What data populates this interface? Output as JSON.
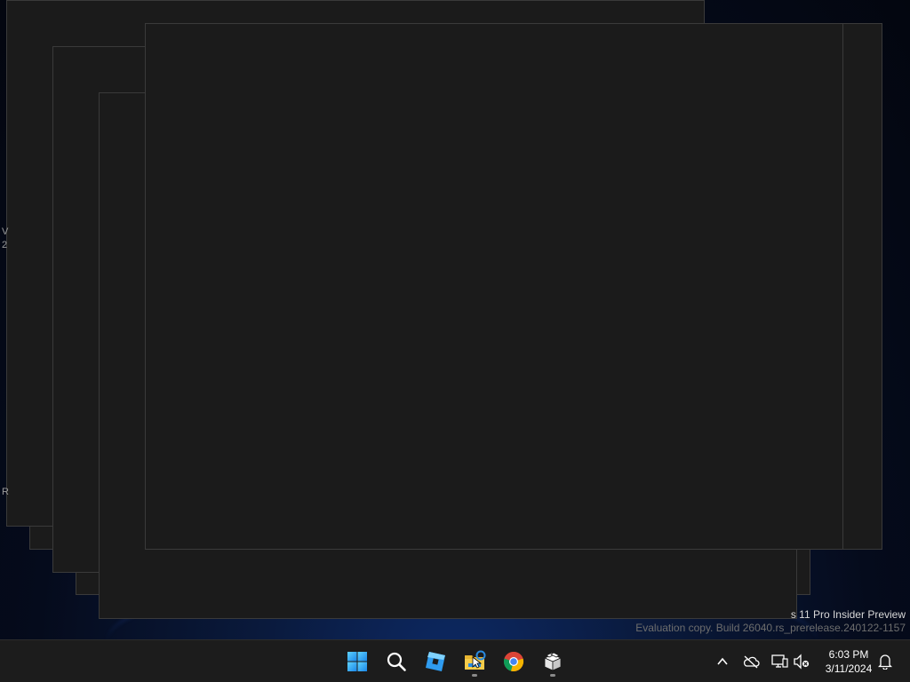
{
  "desktop": {
    "left_edge_texts": [
      "V",
      "2",
      "R"
    ],
    "watermark": {
      "line1": "s 11 Pro Insider Preview",
      "line2": "Evaluation copy. Build 26040.rs_prerelease.240122-1157"
    }
  },
  "taskbar": {
    "icons": [
      "windows-start-icon",
      "search-icon",
      "roblox-studio-icon",
      "file-explorer-icon",
      "chrome-icon",
      "package-icon"
    ],
    "tray": {
      "icons": [
        "chevron-up-icon",
        "onedrive-offline-icon",
        "network-icon",
        "volume-muted-icon",
        "notification-bell-icon"
      ],
      "time": "6:03 PM",
      "date": "3/11/2024"
    }
  },
  "colors": {
    "window_bg": "#1b1b1b",
    "taskbar_bg": "#1c1c1c",
    "accent": "#0078d4"
  }
}
